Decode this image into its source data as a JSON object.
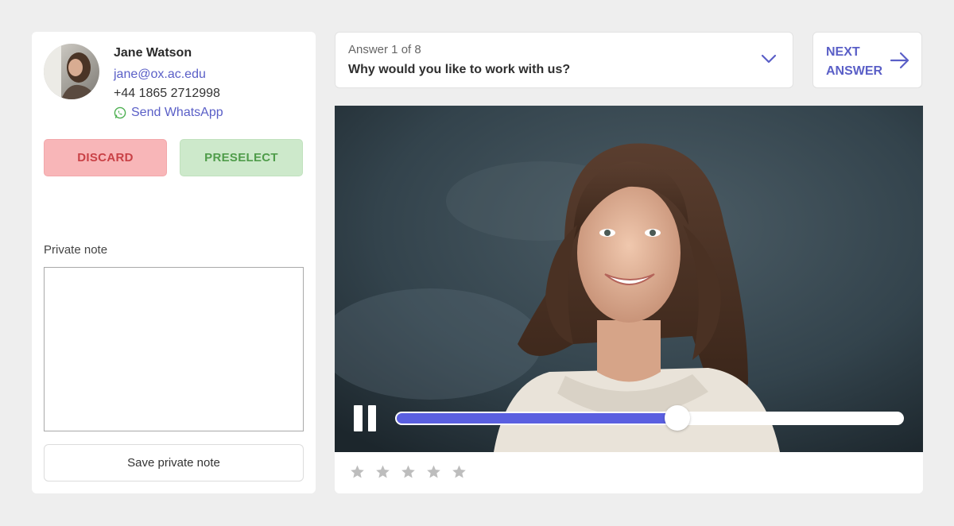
{
  "candidate": {
    "name": "Jane Watson",
    "email": "jane@ox.ac.edu",
    "phone": "+44 1865 2712998",
    "whatsapp_label": "Send WhatsApp",
    "whatsapp_icon": "whatsapp-icon"
  },
  "actions": {
    "discard_label": "DISCARD",
    "preselect_label": "PRESELECT"
  },
  "note": {
    "label": "Private note",
    "value": "",
    "save_label": "Save private note"
  },
  "question": {
    "counter": "Answer 1 of 8",
    "text": "Why would you like to work with us?",
    "dropdown_icon": "chevron-down-icon"
  },
  "next": {
    "label_line1": "NEXT",
    "label_line2": "ANSWER",
    "icon": "arrow-right-icon"
  },
  "player": {
    "state": "playing",
    "control_icon": "pause-icon",
    "progress_fraction": 0.555
  },
  "rating": {
    "max": 5,
    "value": 0
  },
  "colors": {
    "accent": "#5a5fc7",
    "progress": "#5a5fe0",
    "discard_bg": "#f8b6b8",
    "discard_text": "#c94146",
    "preselect_bg": "#cde9cb",
    "preselect_text": "#4f9c4a",
    "whatsapp": "#4caf50",
    "star": "#bdbdbd"
  }
}
